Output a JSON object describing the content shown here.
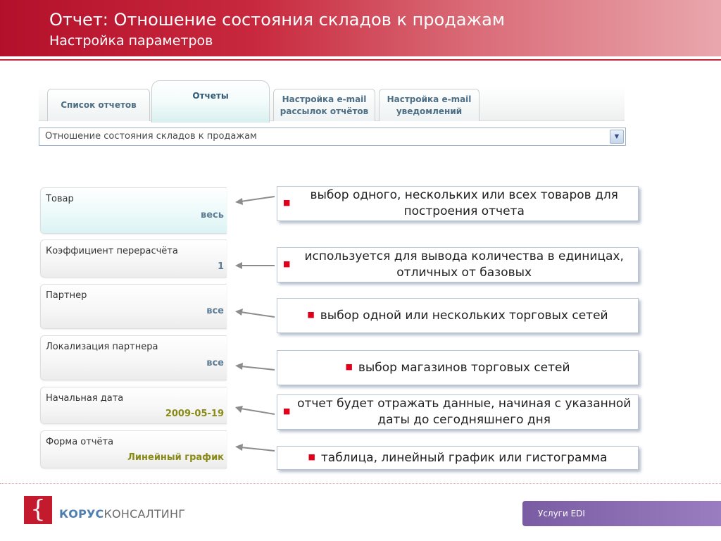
{
  "header": {
    "title": "Отчет: Отношение состояния складов к продажам",
    "subtitle": "Настройка параметров",
    "accent_color": "#c8283d"
  },
  "tabs": [
    {
      "label": "Список отчетов",
      "active": false
    },
    {
      "label": "Отчеты",
      "active": true
    },
    {
      "label": "Настройка e-mail\nрассылок отчётов",
      "active": false
    },
    {
      "label": "Настройка e-mail\nуведомлений",
      "active": false
    }
  ],
  "report_select": {
    "value": "Отношение состояния складов к продажам",
    "icon": "chevron-down-icon"
  },
  "params": [
    {
      "label": "Товар",
      "value": "весь"
    },
    {
      "label": "Коэффициент перерасчёта",
      "value": "1"
    },
    {
      "label": "Партнер",
      "value": "все"
    },
    {
      "label": "Локализация партнера",
      "value": "все"
    },
    {
      "label": "Начальная дата",
      "value": "2009-05-19"
    },
    {
      "label": "Форма отчёта",
      "value": "Линейный график"
    }
  ],
  "callouts": [
    "выбор одного, нескольких или всех товаров для построения отчета",
    "используется для вывода количества в единицах, отличных от базовых",
    "выбор одной или нескольких торговых сетей",
    "выбор магазинов торговых сетей",
    "отчет будет отражать данные, начиная с указанной даты до сегодняшнего дня",
    "таблица, линейный график или гистограмма"
  ],
  "footer": {
    "logo_mark": "{",
    "logo_bold": "КОРУС",
    "logo_rest": "КОНСАЛТИНГ",
    "service": "Услуги EDI"
  }
}
